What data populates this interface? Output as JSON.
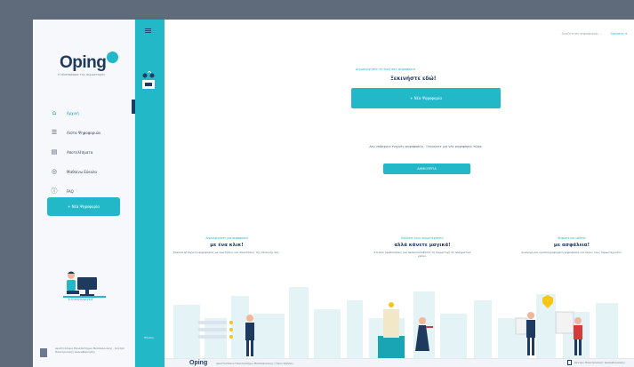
{
  "brand": {
    "name": "Oping",
    "tagline": "Η πλατφόρμα της συμμετοχής"
  },
  "sidebar": {
    "items": [
      {
        "label": "Αρχική",
        "icon": "home-icon"
      },
      {
        "label": "Λίστα Ψηφοφοριών",
        "icon": "list-icon"
      },
      {
        "label": "Αποτελέσματα",
        "icon": "results-icon"
      },
      {
        "label": "Μαθαίνω Εύκολα",
        "icon": "learn-icon"
      },
      {
        "label": "FAQ",
        "icon": "help-icon"
      }
    ],
    "new_vote_button": "+ Νέα Ψηφοφορία",
    "help_link": "Επικοινωνία",
    "footer_text": "Αριστοτέλειο Πανεπιστήμιο Θεσσαλονίκης · Κέντρο Ηλεκτρονικής Διακυβέρνησης"
  },
  "strip": {
    "footer_text": "Έξοδος"
  },
  "topbar": {
    "search_text": "Αναζήτηση ψηφοφορίας...",
    "user": "Χρήστης"
  },
  "hero": {
    "subtitle": "Δημιουργήστε τη δική σας ψηφοφορία",
    "title": "Ξεκινήστε εδώ!",
    "button": "+ Νέα Ψηφοφορία"
  },
  "info": {
    "text": "Δεν υπάρχουν ενεργές ψηφοφορίες. Ξεκινήστε μια νέα ψηφοφορία τώρα.",
    "button": "ΔΗΜΙΟΥΡΓΙΑ"
  },
  "columns": [
    {
      "subtitle": "Δημιουργήστε μια ψηφοφορία",
      "title": "με ένα κλικ!",
      "desc": "Εύκολα φτιάχνετε ψηφοφορίες με ερωτήσεις και απαντήσεις της επιλογής σας."
    },
    {
      "subtitle": "Καλέστε τους συμμετέχοντες",
      "title": "αλλά κάνετε μαγικά!",
      "desc": "Στείλτε προσκλήσεις και παρακολουθήστε τη συμμετοχή σε πραγματικό χρόνο."
    },
    {
      "subtitle": "Ψηφίστε και μάθετε",
      "title": "με ασφάλεια!",
      "desc": "Ανώνυμη και κρυπτογραφημένη ψηφοφορία για όλους τους συμμετέχοντες."
    }
  ],
  "footer": {
    "logo": "Oping",
    "text": "Αριστοτέλειο Πανεπιστήμιο Θεσσαλονίκης | Όροι Χρήσης",
    "right": "Κέντρο Ηλεκτρονικής Διακυβέρνησης"
  },
  "colors": {
    "accent": "#22b8c8",
    "navy": "#1e3a5f",
    "frame": "#5f6b7b"
  }
}
